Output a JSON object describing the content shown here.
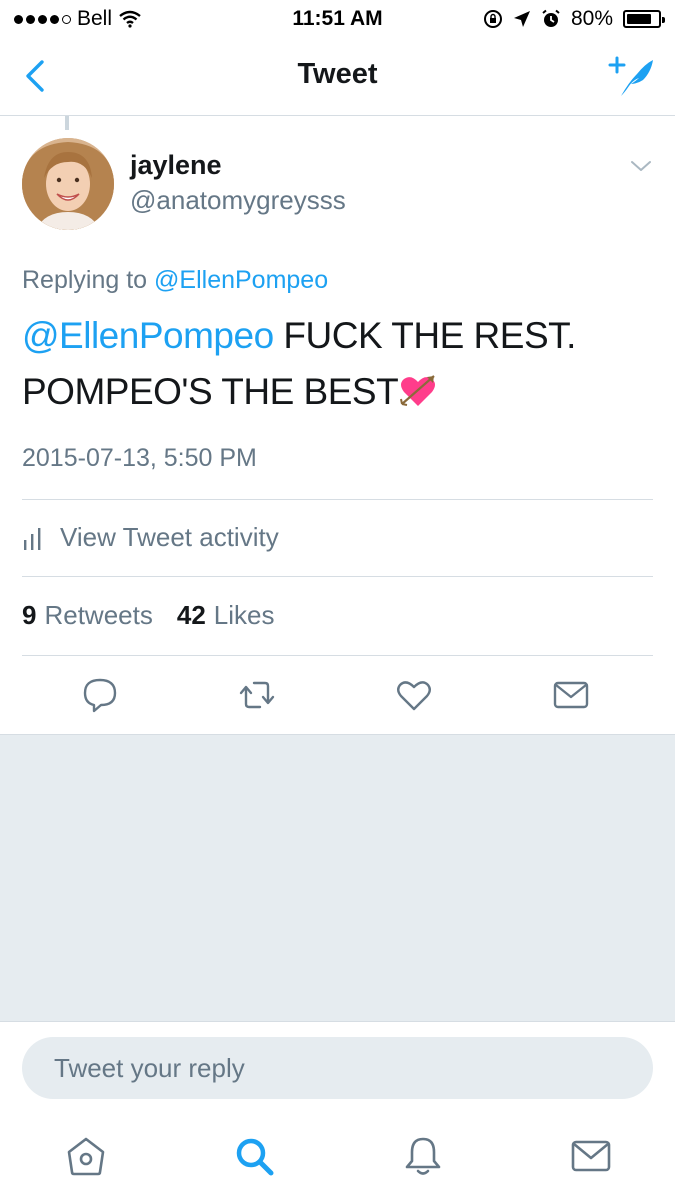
{
  "status_bar": {
    "carrier": "Bell",
    "time": "11:51 AM",
    "battery": "80%",
    "battery_level": 0.8
  },
  "nav": {
    "title": "Tweet",
    "back_icon": "chevron-left-icon",
    "compose_icon": "compose-tweet-icon"
  },
  "tweet": {
    "author_name": "jaylene",
    "author_handle": "@anatomygreysss",
    "replying_label": "Replying to",
    "replying_to": "@EllenPompeo",
    "mention": "@EllenPompeo",
    "text": " FUCK THE REST. POMPEO'S THE BEST",
    "emoji": "heart-with-arrow-emoji",
    "timestamp": "2015-07-13, 5:50 PM"
  },
  "activity": {
    "label": "View Tweet activity"
  },
  "stats": {
    "retweets_count": "9",
    "retweets_label": "Retweets",
    "likes_count": "42",
    "likes_label": "Likes"
  },
  "reply": {
    "placeholder": "Tweet your reply"
  },
  "colors": {
    "accent": "#1da1f2",
    "secondary_text": "#657786",
    "background_gray": "#e6ecf0"
  }
}
